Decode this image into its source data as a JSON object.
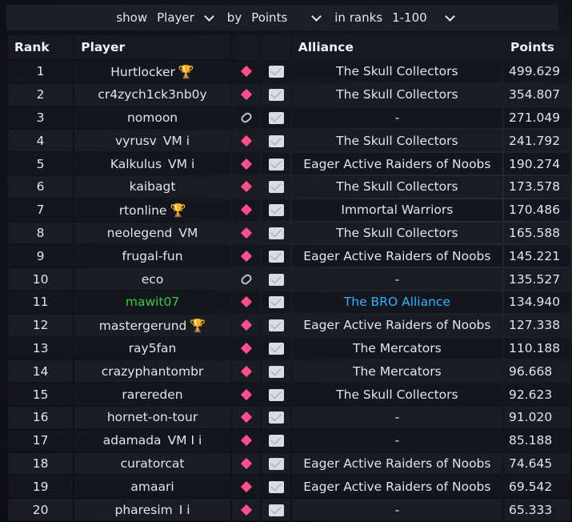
{
  "filter": {
    "show_label": "show",
    "show_value": "Player",
    "by_label": "by",
    "by_value": "Points",
    "ranks_label": "in ranks",
    "ranks_value": "1-100"
  },
  "columns": {
    "rank": "Rank",
    "player": "Player",
    "alliance": "Alliance",
    "points": "Points"
  },
  "rows": [
    {
      "rank": "1",
      "player": "Hurtlocker",
      "flags": "",
      "trophy": true,
      "action": "diamond",
      "alliance": "The Skull Collectors",
      "points": "499.629"
    },
    {
      "rank": "2",
      "player": "cr4zych1ck3nb0y",
      "flags": "",
      "trophy": false,
      "action": "diamond",
      "alliance": "The Skull Collectors",
      "points": "354.807"
    },
    {
      "rank": "3",
      "player": "nomoon",
      "flags": "",
      "trophy": false,
      "action": "link",
      "alliance": "-",
      "points": "271.049"
    },
    {
      "rank": "4",
      "player": "vyrusv",
      "flags": "VM i",
      "trophy": false,
      "action": "diamond",
      "alliance": "The Skull Collectors",
      "points": "241.792"
    },
    {
      "rank": "5",
      "player": "Kalkulus",
      "flags": "VM i",
      "trophy": false,
      "action": "diamond",
      "alliance": "Eager Active Raiders of Noobs",
      "points": "190.274"
    },
    {
      "rank": "6",
      "player": "kaibagt",
      "flags": "",
      "trophy": false,
      "action": "diamond",
      "alliance": "The Skull Collectors",
      "points": "173.578"
    },
    {
      "rank": "7",
      "player": "rtonline",
      "flags": "",
      "trophy": true,
      "action": "diamond",
      "alliance": "Immortal Warriors",
      "points": "170.486"
    },
    {
      "rank": "8",
      "player": "neolegend",
      "flags": "VM",
      "trophy": false,
      "action": "diamond",
      "alliance": "The Skull Collectors",
      "points": "165.588"
    },
    {
      "rank": "9",
      "player": "frugal-fun",
      "flags": "",
      "trophy": false,
      "action": "diamond",
      "alliance": "Eager Active Raiders of Noobs",
      "points": "145.221"
    },
    {
      "rank": "10",
      "player": "eco",
      "flags": "",
      "trophy": false,
      "action": "link",
      "alliance": "-",
      "points": "135.527"
    },
    {
      "rank": "11",
      "player": "mawit07",
      "flags": "",
      "trophy": false,
      "action": "diamond",
      "alliance": "The BRO Alliance",
      "points": "134.940",
      "highlight": true
    },
    {
      "rank": "12",
      "player": "mastergerund",
      "flags": "",
      "trophy": true,
      "action": "diamond",
      "alliance": "Eager Active Raiders of Noobs",
      "points": "127.338"
    },
    {
      "rank": "13",
      "player": "ray5fan",
      "flags": "",
      "trophy": false,
      "action": "diamond",
      "alliance": "The Mercators",
      "points": "110.188"
    },
    {
      "rank": "14",
      "player": "crazyphantombr",
      "flags": "",
      "trophy": false,
      "action": "diamond",
      "alliance": "The Mercators",
      "points": "96.668"
    },
    {
      "rank": "15",
      "player": "rarereden",
      "flags": "",
      "trophy": false,
      "action": "diamond",
      "alliance": "The Skull Collectors",
      "points": "92.623"
    },
    {
      "rank": "16",
      "player": "hornet-on-tour",
      "flags": "",
      "trophy": false,
      "action": "diamond",
      "alliance": "-",
      "points": "91.020"
    },
    {
      "rank": "17",
      "player": "adamada",
      "flags": "VM I i",
      "trophy": false,
      "action": "diamond",
      "alliance": "-",
      "points": "85.188"
    },
    {
      "rank": "18",
      "player": "curatorcat",
      "flags": "",
      "trophy": false,
      "action": "diamond",
      "alliance": "Eager Active Raiders of Noobs",
      "points": "74.645"
    },
    {
      "rank": "19",
      "player": "amaari",
      "flags": "",
      "trophy": false,
      "action": "diamond",
      "alliance": "Eager Active Raiders of Noobs",
      "points": "69.542"
    },
    {
      "rank": "20",
      "player": "pharesim",
      "flags": "I i",
      "trophy": false,
      "action": "diamond",
      "alliance": "-",
      "points": "65.333"
    }
  ],
  "colors": {
    "action_diamond": "#ff4f8b",
    "trophy": "#f2c400",
    "own_player": "#2ecc40",
    "own_alliance": "#2ab3ff"
  },
  "icons": {
    "trophy": "trophy-icon",
    "diamond": "diamond-icon",
    "link": "link-icon",
    "message": "envelope-icon"
  }
}
